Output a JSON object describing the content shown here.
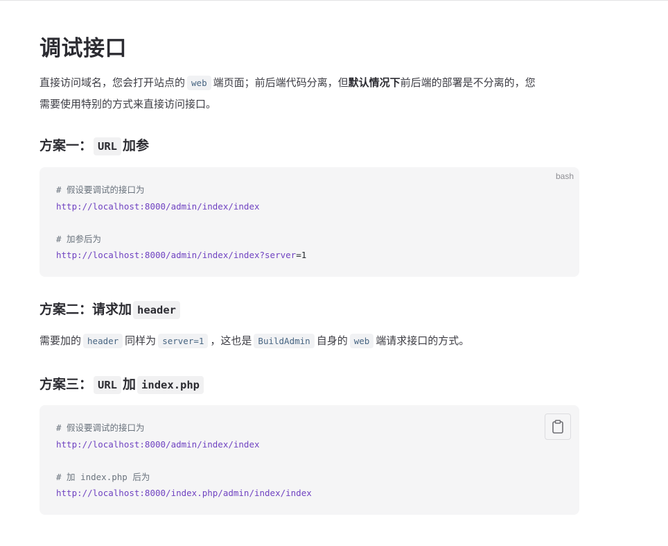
{
  "title": "调试接口",
  "intro": {
    "p1": "直接访问域名，您会打开站点的",
    "code": "web",
    "p2": "端页面；前后端代码分离，但",
    "strong": "默认情况下",
    "p3": "前后端的部署是不分离的，您",
    "line2": "需要使用特别的方式来直接访问接口。"
  },
  "section1": {
    "prefix": "方案一：",
    "code": "URL",
    "suffix": "加参",
    "lang": "bash",
    "code_lines": [
      {
        "type": "cmt",
        "text": "# 假设要调试的接口为"
      },
      {
        "type": "url",
        "text": "http://localhost:8000/admin/index/index"
      },
      {
        "type": "blank",
        "text": ""
      },
      {
        "type": "cmt",
        "text": "# 加参后为"
      },
      {
        "type": "url",
        "text": "http://localhost:8000/admin/index/index?server",
        "tail": "=1"
      }
    ]
  },
  "section2": {
    "prefix": "方案二：请求加",
    "code": "header",
    "para": {
      "t1": "需要加的",
      "c1": "header",
      "t2": "同样为",
      "c2": "server=1",
      "t3": "，这也是",
      "c3": "BuildAdmin",
      "t4": "自身的",
      "c4": "web",
      "t5": "端请求接口的方式。"
    }
  },
  "section3": {
    "prefix": "方案三：",
    "code1": "URL",
    "mid": "加",
    "code2": "index.php",
    "code_lines": [
      {
        "type": "cmt",
        "text": "# 假设要调试的接口为"
      },
      {
        "type": "url",
        "text": "http://localhost:8000/admin/index/index"
      },
      {
        "type": "blank",
        "text": ""
      },
      {
        "type": "cmt",
        "text": "# 加 index.php 后为"
      },
      {
        "type": "url",
        "text": "http://localhost:8000/index.php/admin/index/index"
      }
    ]
  }
}
